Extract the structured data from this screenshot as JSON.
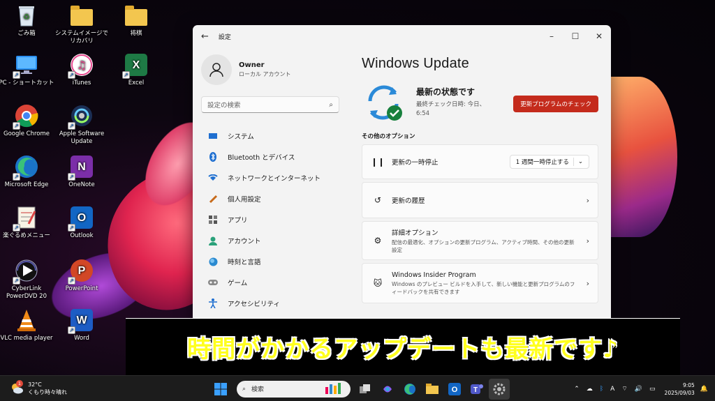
{
  "desktop": {
    "icons": [
      {
        "label": "ごみ箱"
      },
      {
        "label": "システムイメージでリカバリ"
      },
      {
        "label": "将棋"
      },
      {
        "label": "PC - ショートカット"
      },
      {
        "label": "iTunes"
      },
      {
        "label": "Excel"
      },
      {
        "label": "Google Chrome"
      },
      {
        "label": "Apple Software Update"
      },
      {
        "label": "Microsoft Edge"
      },
      {
        "label": "OneNote"
      },
      {
        "label": "楽ぐるめメニュー"
      },
      {
        "label": "Outlook"
      },
      {
        "label": "CyberLink PowerDVD 20"
      },
      {
        "label": "PowerPoint"
      },
      {
        "label": "VLC media player"
      },
      {
        "label": "Word"
      }
    ]
  },
  "window": {
    "title": "設定",
    "profile": {
      "name": "Owner",
      "account_type": "ローカル アカウント"
    },
    "search_placeholder": "設定の検索",
    "nav": [
      {
        "label": "システム",
        "icon": "monitor-icon"
      },
      {
        "label": "Bluetooth とデバイス",
        "icon": "bluetooth-icon"
      },
      {
        "label": "ネットワークとインターネット",
        "icon": "wifi-icon"
      },
      {
        "label": "個人用設定",
        "icon": "brush-icon"
      },
      {
        "label": "アプリ",
        "icon": "apps-icon"
      },
      {
        "label": "アカウント",
        "icon": "person-icon"
      },
      {
        "label": "時刻と言語",
        "icon": "globe-icon"
      },
      {
        "label": "ゲーム",
        "icon": "gamepad-icon"
      },
      {
        "label": "アクセシビリティ",
        "icon": "accessibility-icon"
      }
    ],
    "page_title": "Windows Update",
    "status": {
      "heading": "最新の状態です",
      "last_check": "最終チェック日時: 今日、6:54"
    },
    "check_button": "更新プログラムのチェック",
    "other_options_title": "その他のオプション",
    "options": [
      {
        "title": "更新の一時停止",
        "dropdown": "1 週間一時停止する",
        "icon": "pause-icon"
      },
      {
        "title": "更新の履歴",
        "icon": "history-icon"
      },
      {
        "title": "詳細オプション",
        "desc": "配信の最適化、オプションの更新プログラム、アクティブ時間、その他の更新設定",
        "icon": "gears-icon"
      },
      {
        "title": "Windows Insider Program",
        "desc": "Windows のプレビュー ビルドを入手して、新しい機能と更新プログラムのフィードバックを共有できます",
        "icon": "cat-icon"
      }
    ],
    "accent_color": "#c42b1c"
  },
  "caption": "時間がかかるアップデートも最新です♪",
  "taskbar": {
    "weather": {
      "temp": "32°C",
      "condition": "くもり時々晴れ",
      "badge": "1"
    },
    "search_placeholder": "検索",
    "time": "9:05",
    "date": "2025/09/03",
    "ime": "A"
  }
}
